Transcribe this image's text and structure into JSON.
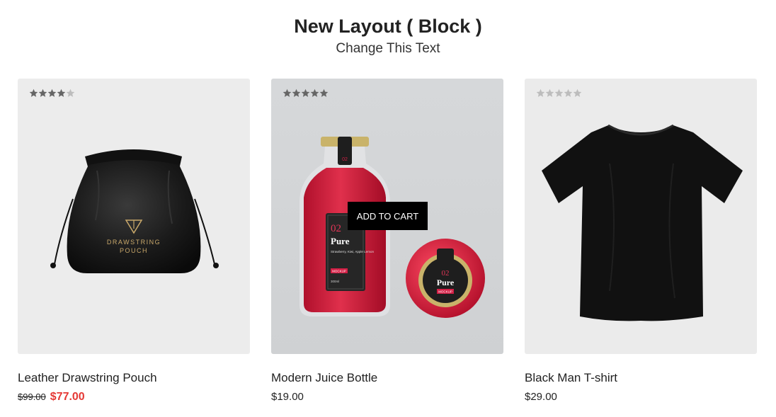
{
  "section": {
    "title": "New Layout ( Block )",
    "subtitle": "Change This Text"
  },
  "colors": {
    "sale_price": "#e53935",
    "button_bg": "#000000",
    "star_filled": "#666666",
    "star_empty": "#bdbdbd"
  },
  "products": [
    {
      "name": "Leather Drawstring Pouch",
      "rating": 4,
      "rating_max": 5,
      "old_price": "$99.00",
      "price": "$77.00",
      "on_sale": true,
      "image_icon": "drawstring-pouch-image",
      "image_text": [
        "DRAWSTRING",
        "POUCH"
      ]
    },
    {
      "name": "Modern Juice Bottle",
      "rating": 5,
      "rating_max": 5,
      "price": "$19.00",
      "on_sale": false,
      "image_icon": "juice-bottle-image",
      "add_to_cart_label": "ADD TO CART",
      "image_text": {
        "number": "02",
        "brand": "Pure",
        "flavor": "Strawberry, Kiwi, Apple Lemon",
        "tag": "MOCKUP",
        "volume": "300ml"
      }
    },
    {
      "name": "Black Man T-shirt",
      "rating": 0,
      "rating_max": 5,
      "price": "$29.00",
      "on_sale": false,
      "image_icon": "black-tshirt-image"
    }
  ]
}
